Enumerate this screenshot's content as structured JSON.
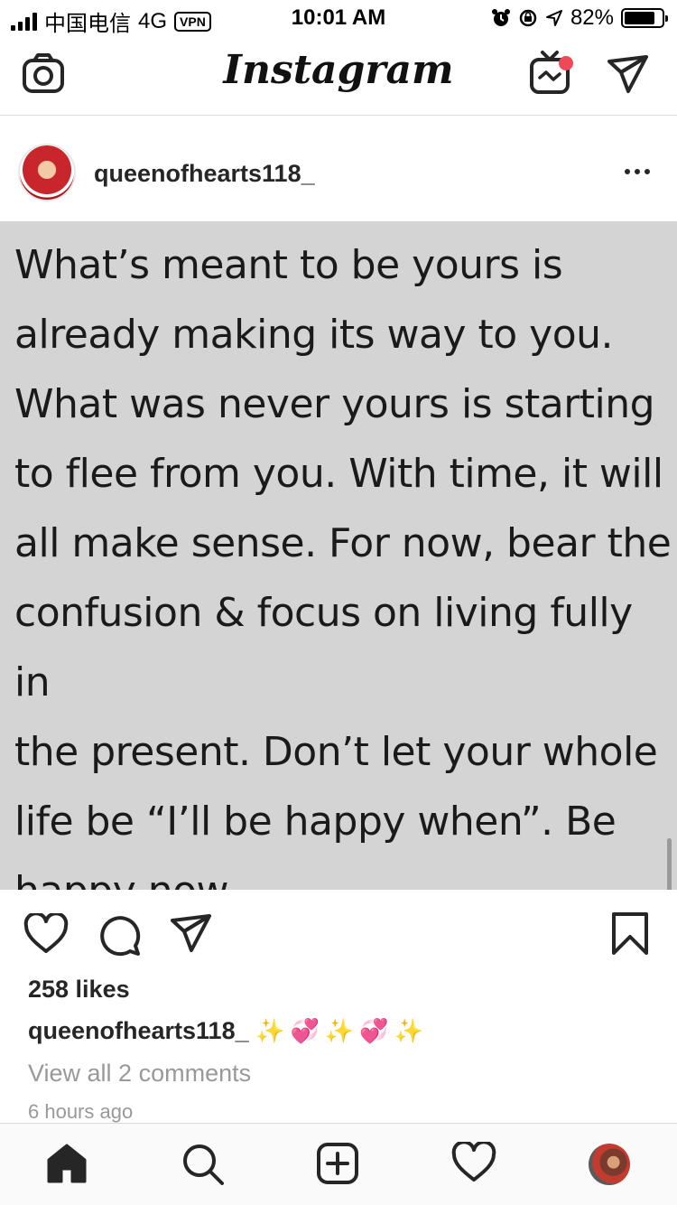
{
  "status_bar": {
    "carrier": "中国电信",
    "network": "4G",
    "vpn": "VPN",
    "time": "10:01 AM",
    "battery": "82%"
  },
  "header": {
    "logo": "Instagram",
    "icons": [
      "camera-icon",
      "igtv-icon",
      "direct-message-icon"
    ],
    "igtv_badge_color": "#ed4956"
  },
  "post": {
    "username": "queenofhearts118_",
    "quote_lines": [
      "What’s meant to be yours is",
      "already making its way to you.",
      "What was never yours is starting",
      "to flee from you. With time, it will",
      "all make sense. For now, bear the",
      "confusion & focus on living fully in",
      "the present. Don’t let your whole",
      "life be “I’ll be happy when”. Be",
      "happy now."
    ],
    "image_background": "#d4d4d4",
    "likes": "258 likes",
    "caption_user": "queenofhearts118_",
    "caption_text": "✨💞✨💞✨",
    "view_comments": "View all 2 comments",
    "time_ago": "6 hours ago"
  },
  "tab_bar": {
    "items": [
      "home-icon",
      "search-icon",
      "new-post-icon",
      "activity-icon",
      "profile-avatar"
    ]
  }
}
